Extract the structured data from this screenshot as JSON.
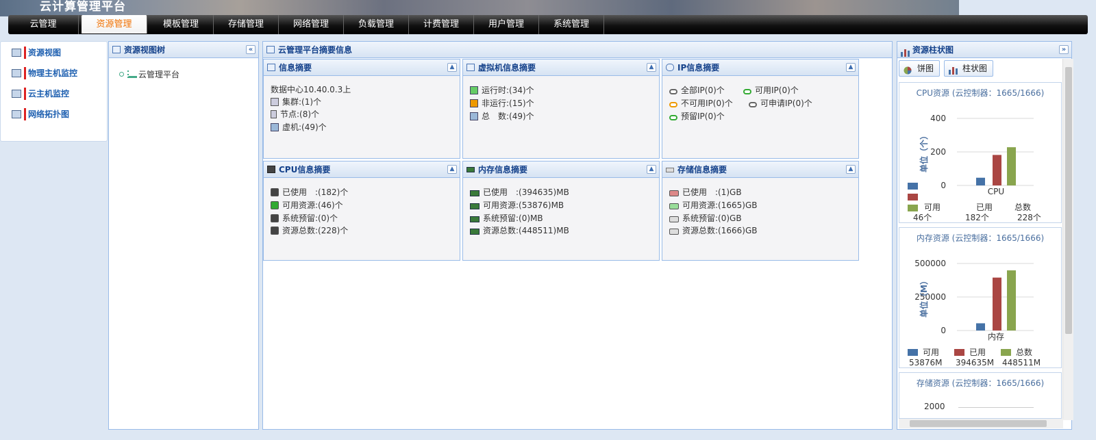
{
  "app": {
    "title": "云计算管理平台"
  },
  "nav": {
    "tabs": [
      "云管理",
      "资源管理",
      "模板管理",
      "存储管理",
      "网络管理",
      "负载管理",
      "计费管理",
      "用户管理",
      "系统管理"
    ],
    "active": "资源管理"
  },
  "sidebar": {
    "items": [
      "资源视图",
      "物理主机监控",
      "云主机监控",
      "网络拓扑图"
    ]
  },
  "tree_panel": {
    "title": "资源视图树",
    "root": "云管理平台"
  },
  "summary_panel": {
    "title": "云管理平台摘要信息",
    "info": {
      "title": "信息摘要",
      "datacenter": "数据中心10.40.0.3上",
      "cluster": "集群:(1)个",
      "node": "节点:(8)个",
      "vm": "虚机:(49)个"
    },
    "vm_info": {
      "title": "虚拟机信息摘要",
      "running": "运行时:(34)个",
      "stopped": "非运行:(15)个",
      "total": "总　数:(49)个"
    },
    "ip_info": {
      "title": "IP信息摘要",
      "all": "全部IP(0)个",
      "available": "可用IP(0)个",
      "unavailable": "不可用IP(0)个",
      "applicable": "可申请IP(0)个",
      "reserved": "预留IP(0)个"
    },
    "cpu_info": {
      "title": "CPU信息摘要",
      "used": "已使用　:(182)个",
      "available": "可用资源:(46)个",
      "reserved": "系统预留:(0)个",
      "total": "资源总数:(228)个"
    },
    "mem_info": {
      "title": "内存信息摘要",
      "used": "已使用　:(394635)MB",
      "available": "可用资源:(53876)MB",
      "reserved": "系统预留:(0)MB",
      "total": "资源总数:(448511)MB"
    },
    "storage_info": {
      "title": "存储信息摘要",
      "used": "已使用　:(1)GB",
      "available": "可用资源:(1665)GB",
      "reserved": "系统预留:(0)GB",
      "total": "资源总数:(1666)GB"
    }
  },
  "chart_panel": {
    "title": "资源柱状图",
    "buttons": {
      "pie": "饼图",
      "bar": "柱状图"
    }
  },
  "colors": {
    "available": "#4572a7",
    "used": "#aa4643",
    "total": "#89a54e",
    "accent": "#f07000"
  },
  "chart_data": [
    {
      "type": "bar",
      "title": "CPU资源 (云控制器：1665/1666)",
      "ylabel": "单位（个）",
      "categories": [
        "CPU"
      ],
      "ylim": [
        0,
        400
      ],
      "yticks": [
        0,
        200,
        400
      ],
      "series": [
        {
          "name": "可用",
          "values": [
            46
          ],
          "label": "46个"
        },
        {
          "name": "已用",
          "values": [
            182
          ],
          "label": "182个"
        },
        {
          "name": "总数",
          "values": [
            228
          ],
          "label": "228个"
        }
      ]
    },
    {
      "type": "bar",
      "title": "内存资源 (云控制器：1665/1666)",
      "ylabel": "单位（M）",
      "categories": [
        "内存"
      ],
      "ylim": [
        0,
        500000
      ],
      "yticks": [
        "0",
        "250000",
        "500000"
      ],
      "series": [
        {
          "name": "可用",
          "values": [
            53876
          ],
          "label": "53876M"
        },
        {
          "name": "已用",
          "values": [
            394635
          ],
          "label": "394635M"
        },
        {
          "name": "总数",
          "values": [
            448511
          ],
          "label": "448511M"
        }
      ]
    },
    {
      "type": "bar",
      "title": "存储资源 (云控制器：1665/1666)",
      "yticks": [
        "2000"
      ],
      "categories": [],
      "series": []
    }
  ]
}
